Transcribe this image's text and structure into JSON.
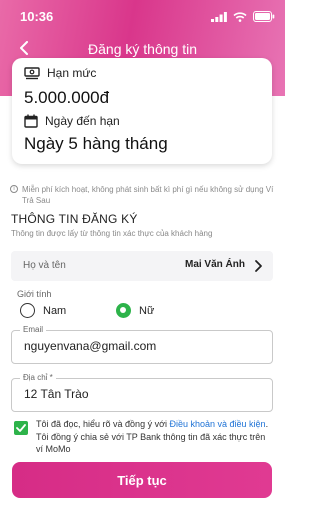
{
  "status_bar": {
    "time": "10:36"
  },
  "nav": {
    "title": "Đăng ký thông tin"
  },
  "card": {
    "limit_label": "Hạn mức",
    "limit_value": "5.000.000đ",
    "due_label": "Ngày đến hạn",
    "due_value": "Ngày 5 hàng tháng"
  },
  "notice": "Miễn phí kích hoạt, không phát sinh bất kì phí gì nếu không sử dụng Ví Trả Sau",
  "section": {
    "title": "THÔNG TIN ĐĂNG KÝ",
    "subtitle": "Thông tin được lấy từ thông tin xác thực của khách hàng"
  },
  "name_row": {
    "label": "Họ và tên",
    "value": "Mai Văn Ánh"
  },
  "gender": {
    "label": "Giới tính",
    "options": [
      "Nam",
      "Nữ"
    ],
    "selected": "Nữ"
  },
  "email": {
    "label": "Email",
    "value": "nguyenvana@gmail.com"
  },
  "address": {
    "label": "Địa chỉ *",
    "value": "12 Tân Trào"
  },
  "agreement": {
    "text_before": "Tôi đã đọc, hiểu rõ và đồng ý với ",
    "link": "Điều khoản và điều kiện",
    "text_after": ". Tôi đồng ý chia sẻ với TP Bank thông tin đã xác thực trên ví MoMo",
    "checked": true
  },
  "continue_button": "Tiếp tục",
  "colors": {
    "brand": "#d82d88",
    "check": "#2db34a",
    "link": "#1f73d6"
  }
}
